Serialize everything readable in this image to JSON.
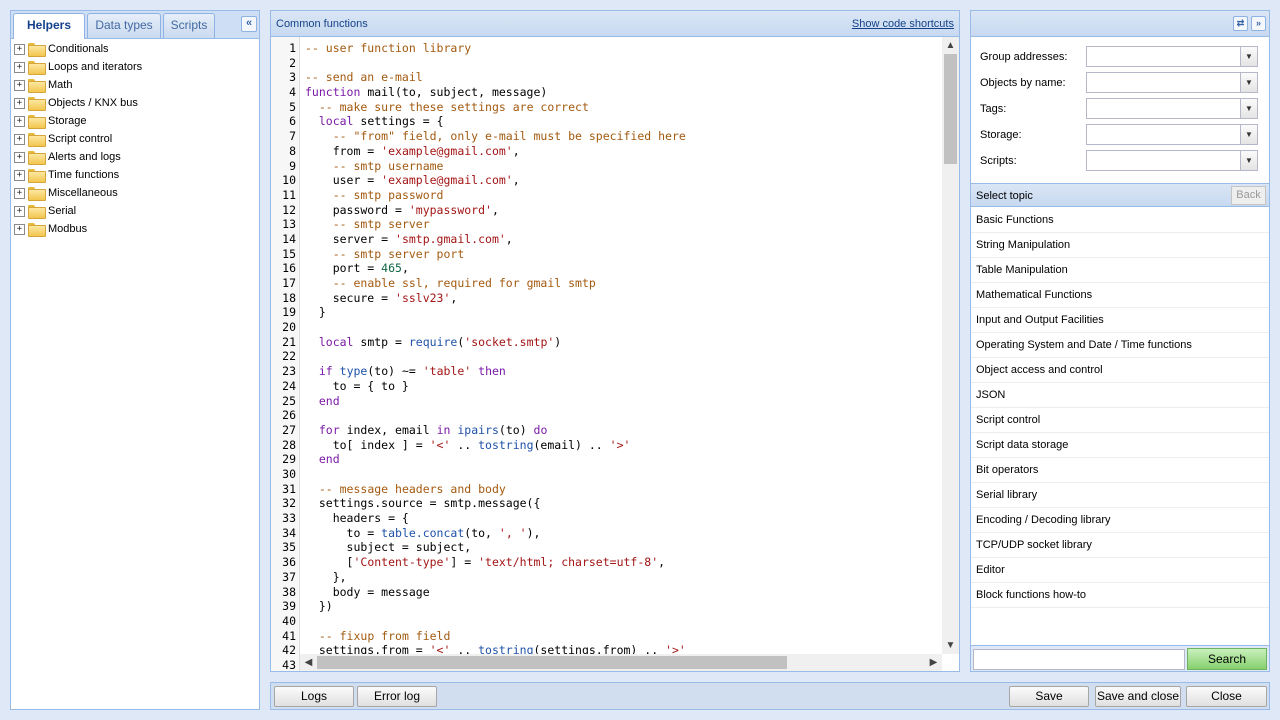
{
  "left": {
    "tabs": [
      {
        "label": "Helpers"
      },
      {
        "label": "Data types"
      },
      {
        "label": "Scripts"
      }
    ],
    "collapse_icon": "double-chevron-left-icon",
    "tree": [
      {
        "label": "Conditionals"
      },
      {
        "label": "Loops and iterators"
      },
      {
        "label": "Math"
      },
      {
        "label": "Objects / KNX bus"
      },
      {
        "label": "Storage"
      },
      {
        "label": "Script control"
      },
      {
        "label": "Alerts and logs"
      },
      {
        "label": "Time functions"
      },
      {
        "label": "Miscellaneous"
      },
      {
        "label": "Serial"
      },
      {
        "label": "Modbus"
      }
    ]
  },
  "editor": {
    "title": "Common functions",
    "shortcuts_link": "Show code shortcuts",
    "lines": [
      "-- user function library",
      "",
      "-- send an e-mail",
      "function mail(to, subject, message)",
      "  -- make sure these settings are correct",
      "  local settings = {",
      "    -- \"from\" field, only e-mail must be specified here",
      "    from = 'example@gmail.com',",
      "    -- smtp username",
      "    user = 'example@gmail.com',",
      "    -- smtp password",
      "    password = 'mypassword',",
      "    -- smtp server",
      "    server = 'smtp.gmail.com',",
      "    -- smtp server port",
      "    port = 465,",
      "    -- enable ssl, required for gmail smtp",
      "    secure = 'sslv23',",
      "  }",
      "",
      "  local smtp = require('socket.smtp')",
      "",
      "  if type(to) ~= 'table' then",
      "    to = { to }",
      "  end",
      "",
      "  for index, email in ipairs(to) do",
      "    to[ index ] = '<' .. tostring(email) .. '>'",
      "  end",
      "",
      "  -- message headers and body",
      "  settings.source = smtp.message({",
      "    headers = {",
      "      to = table.concat(to, ', '),",
      "      subject = subject,",
      "      ['Content-type'] = 'text/html; charset=utf-8',",
      "    },",
      "    body = message",
      "  })",
      "",
      "  -- fixup from field",
      "  settings.from = '<' .. tostring(settings.from) .. '>'",
      ""
    ]
  },
  "right": {
    "refresh_icon": "refresh-icon",
    "expand_icon": "double-chevron-right-icon",
    "filters": [
      {
        "label": "Group addresses:",
        "value": ""
      },
      {
        "label": "Objects by name:",
        "value": ""
      },
      {
        "label": "Tags:",
        "value": ""
      },
      {
        "label": "Storage:",
        "value": ""
      },
      {
        "label": "Scripts:",
        "value": ""
      }
    ],
    "select_topic": "Select topic",
    "back_label": "Back",
    "topics": [
      "Basic Functions",
      "String Manipulation",
      "Table Manipulation",
      "Mathematical Functions",
      "Input and Output Facilities",
      "Operating System and Date / Time functions",
      "Object access and control",
      "JSON",
      "Script control",
      "Script data storage",
      "Bit operators",
      "Serial library",
      "Encoding / Decoding library",
      "TCP/UDP socket library",
      "Editor",
      "Block functions how-to"
    ],
    "search_value": "",
    "search_label": "Search"
  },
  "toolbar": {
    "logs": "Logs",
    "error_log": "Error log",
    "save": "Save",
    "save_close": "Save and close",
    "close": "Close"
  }
}
